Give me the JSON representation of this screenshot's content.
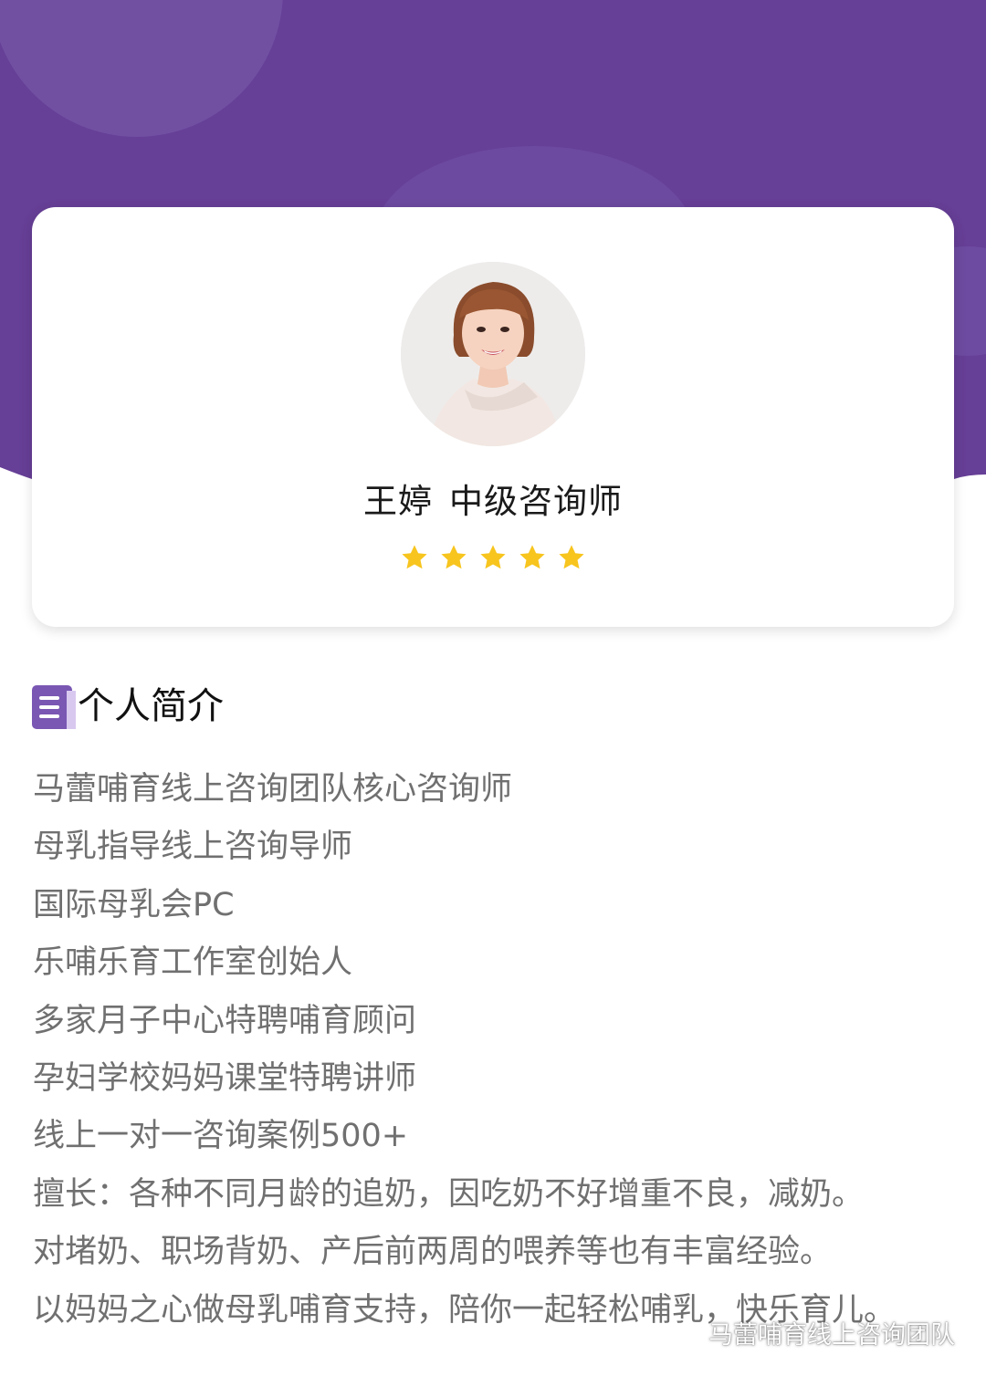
{
  "theme": {
    "header_color": "#663f96",
    "accent_color": "#7a57b3",
    "star_color": "#f7c51e"
  },
  "profile": {
    "name": "王婷",
    "title": "中级咨询师",
    "avatar_icon": "portrait-photo",
    "rating_stars": 5,
    "rating_max": 5
  },
  "section": {
    "icon": "document-list-icon",
    "title": "个人简介"
  },
  "bio": [
    "马蕾哺育线上咨询团队核心咨询师",
    "母乳指导线上咨询导师",
    "国际母乳会PC",
    "乐哺乐育工作室创始人",
    "多家月子中心特聘哺育顾问",
    "孕妇学校妈妈课堂特聘讲师",
    "线上一对一咨询案例500+",
    "擅长：各种不同月龄的追奶，因吃奶不好增重不良，减奶。",
    "对堵奶、职场背奶、产后前两周的喂养等也有丰富经验。",
    "以妈妈之心做母乳哺育支持，陪你一起轻松哺乳，快乐育儿。"
  ],
  "watermark": {
    "icon": "wechat-icon",
    "text": "马蕾哺育线上咨询团队"
  }
}
